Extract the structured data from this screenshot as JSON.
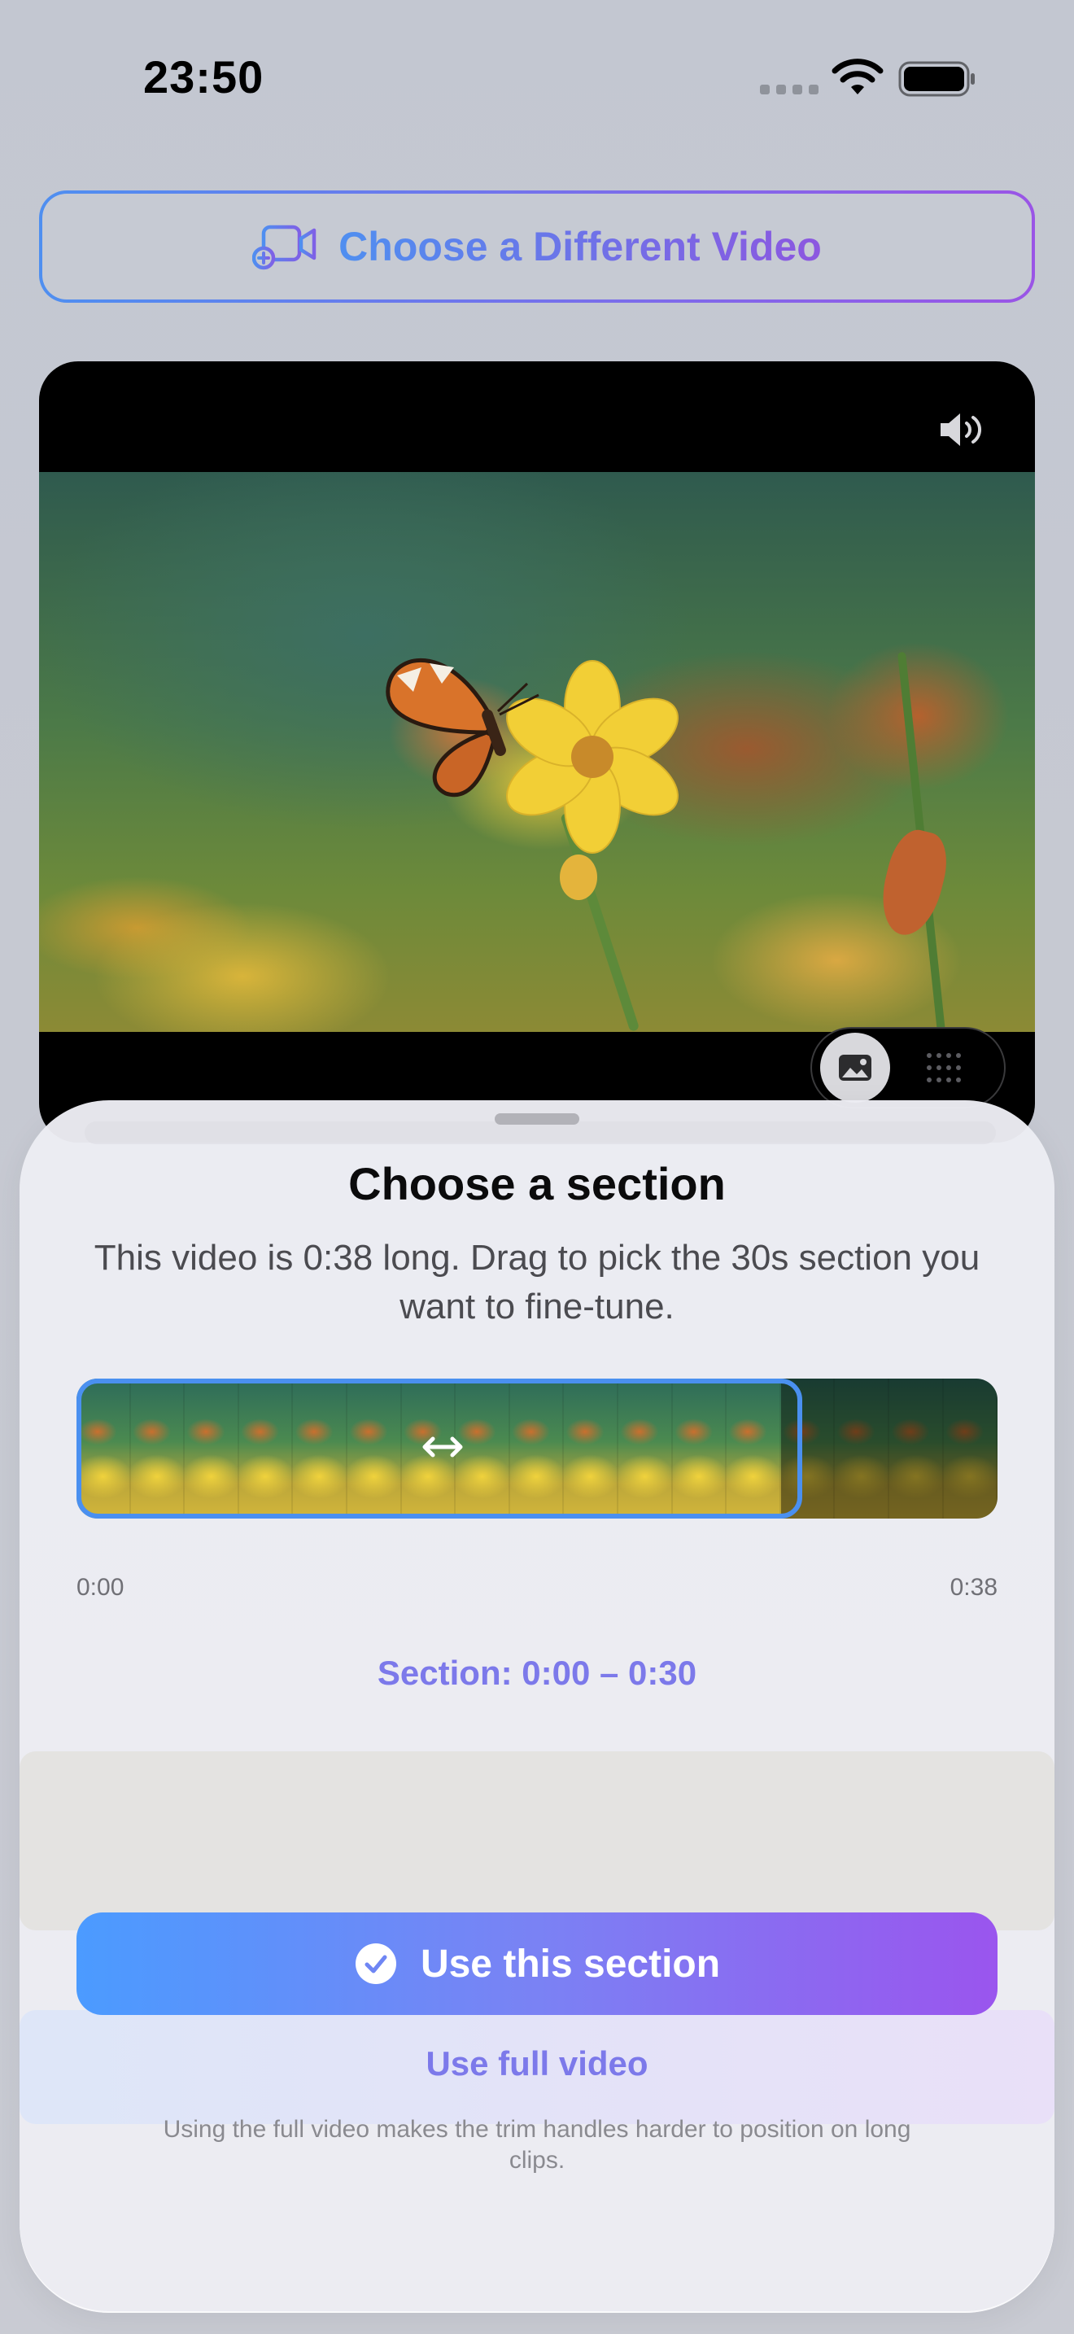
{
  "status_bar": {
    "time": "23:50"
  },
  "header": {
    "choose_video_label": "Choose a Different Video"
  },
  "video": {
    "filmstrip_frames_selected": 13,
    "filmstrip_frames_dim": 4
  },
  "sheet": {
    "title": "Choose a section",
    "description": "This video is 0:38 long. Drag to pick the 30s section you want to fine-tune.",
    "timeline_start": "0:00",
    "timeline_end": "0:38",
    "section_range": "Section: 0:00 – 0:30",
    "use_section_label": "Use this section",
    "use_full_label": "Use full video",
    "footnote": "Using the full video makes the trim handles harder to position on long clips."
  },
  "colors": {
    "accent_blue": "#4a90f0",
    "accent_purple": "#9a55ee",
    "link_purple": "#7c79ea"
  },
  "icons": [
    "wifi-icon",
    "battery-icon",
    "video-plus-icon",
    "volume-icon",
    "photo-icon",
    "grid-icon",
    "resize-horizontal-icon",
    "checkmark-circle-icon"
  ]
}
